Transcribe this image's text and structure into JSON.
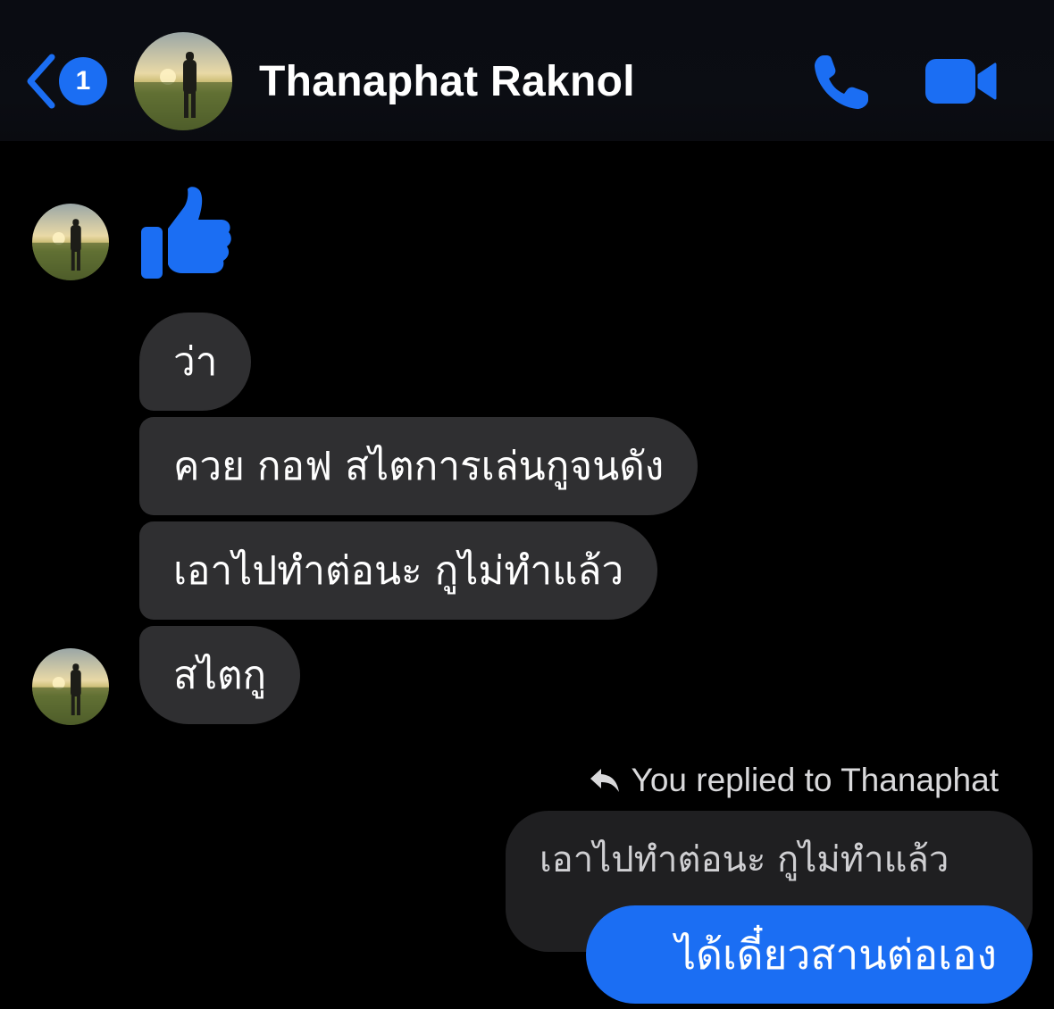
{
  "header": {
    "back_badge_count": "1",
    "contact_name": "Thanaphat Raknol",
    "accent_color": "#1b6ef3",
    "icons": [
      "chevron-left-icon",
      "phone-icon",
      "video-camera-icon"
    ]
  },
  "messages": {
    "received": [
      {
        "type": "like",
        "icon": "thumbs-up-icon"
      },
      {
        "text": "ว่า"
      },
      {
        "text": "ควย กอฟ สไตการเล่นกูจนดัง"
      },
      {
        "text": "เอาไปทำต่อนะ กูไม่ทำแล้ว"
      },
      {
        "text": "สไตกู"
      }
    ],
    "reply": {
      "label": "You replied to Thanaphat",
      "quoted_text": "เอาไปทำต่อนะ กูไม่ทำแล้ว",
      "sent_text": "ได้เดี๋ยวสานต่อเอง"
    }
  },
  "colors": {
    "background": "#000000",
    "received_bubble": "#2f2f31",
    "quoted_bubble": "#1f1f21",
    "sent_bubble": "#1b6ef3"
  }
}
